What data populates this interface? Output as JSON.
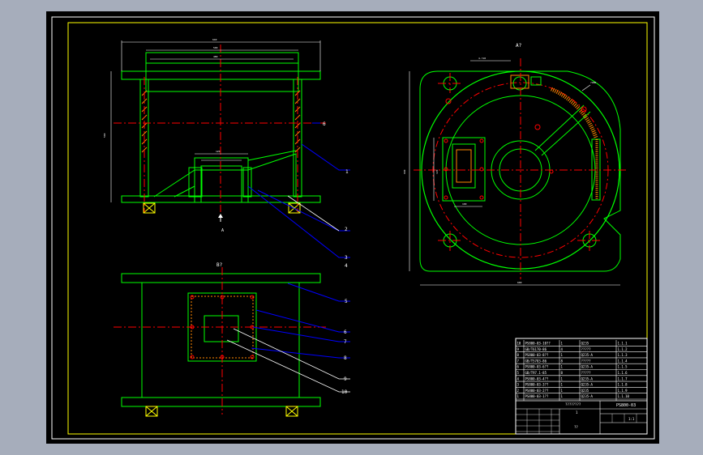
{
  "drawing": {
    "section_label_top": "A?",
    "section_label_bottom": "B?",
    "view_arrow_label": "A",
    "callouts": [
      "1",
      "2",
      "3",
      "4",
      "5",
      "6",
      "7",
      "8",
      "9",
      "10"
    ],
    "callout_6_top": "6",
    "title_block": {
      "drawing_no": "PS800-03",
      "name_line": "????????",
      "scale_label": "1:1",
      "footer": "??",
      "sheet": "1",
      "rows": [
        {
          "no": "10",
          "code": "PS800-03-10??",
          "qty": "1",
          "mat": "Q235",
          "note": "1.1.1"
        },
        {
          "no": "9",
          "code": "GB/T6170-86",
          "qty": "4",
          "mat": "?????",
          "note": "1.1.2"
        },
        {
          "no": "8",
          "code": "PS800-03-8??",
          "qty": "1",
          "mat": "Q235-A",
          "note": "1.1.3"
        },
        {
          "no": "7",
          "code": "GB/T5783-86",
          "qty": "8",
          "mat": "?????",
          "note": "1.1.4"
        },
        {
          "no": "6",
          "code": "PS800-03-6??",
          "qty": "1",
          "mat": "Q235-A",
          "note": "1.1.5"
        },
        {
          "no": "5",
          "code": "GB/T97.1-85",
          "qty": "8",
          "mat": "?????",
          "note": "1.1.6"
        },
        {
          "no": "4",
          "code": "PS800-03-4??",
          "qty": "1",
          "mat": "Q235-A",
          "note": "1.1.7"
        },
        {
          "no": "3",
          "code": "PS800-03-3??",
          "qty": "1",
          "mat": "Q235-A",
          "note": "1.1.8"
        },
        {
          "no": "2",
          "code": "PS800-03-2??",
          "qty": "1",
          "mat": "Q235",
          "note": "1.1.9"
        },
        {
          "no": "1",
          "code": "PS800-03-1??",
          "qty": "1",
          "mat": "Q235-A",
          "note": "1.1.10"
        }
      ]
    }
  },
  "colors": {
    "outer_bg": "#a6adbb",
    "sheet": "#000000",
    "border": "#ffffff",
    "frame": "#ffff00",
    "outline": "#00ff00",
    "center": "#ff0000",
    "dim": "#ffffff",
    "leader": "#0000ff",
    "hatch": "#ff8800"
  }
}
